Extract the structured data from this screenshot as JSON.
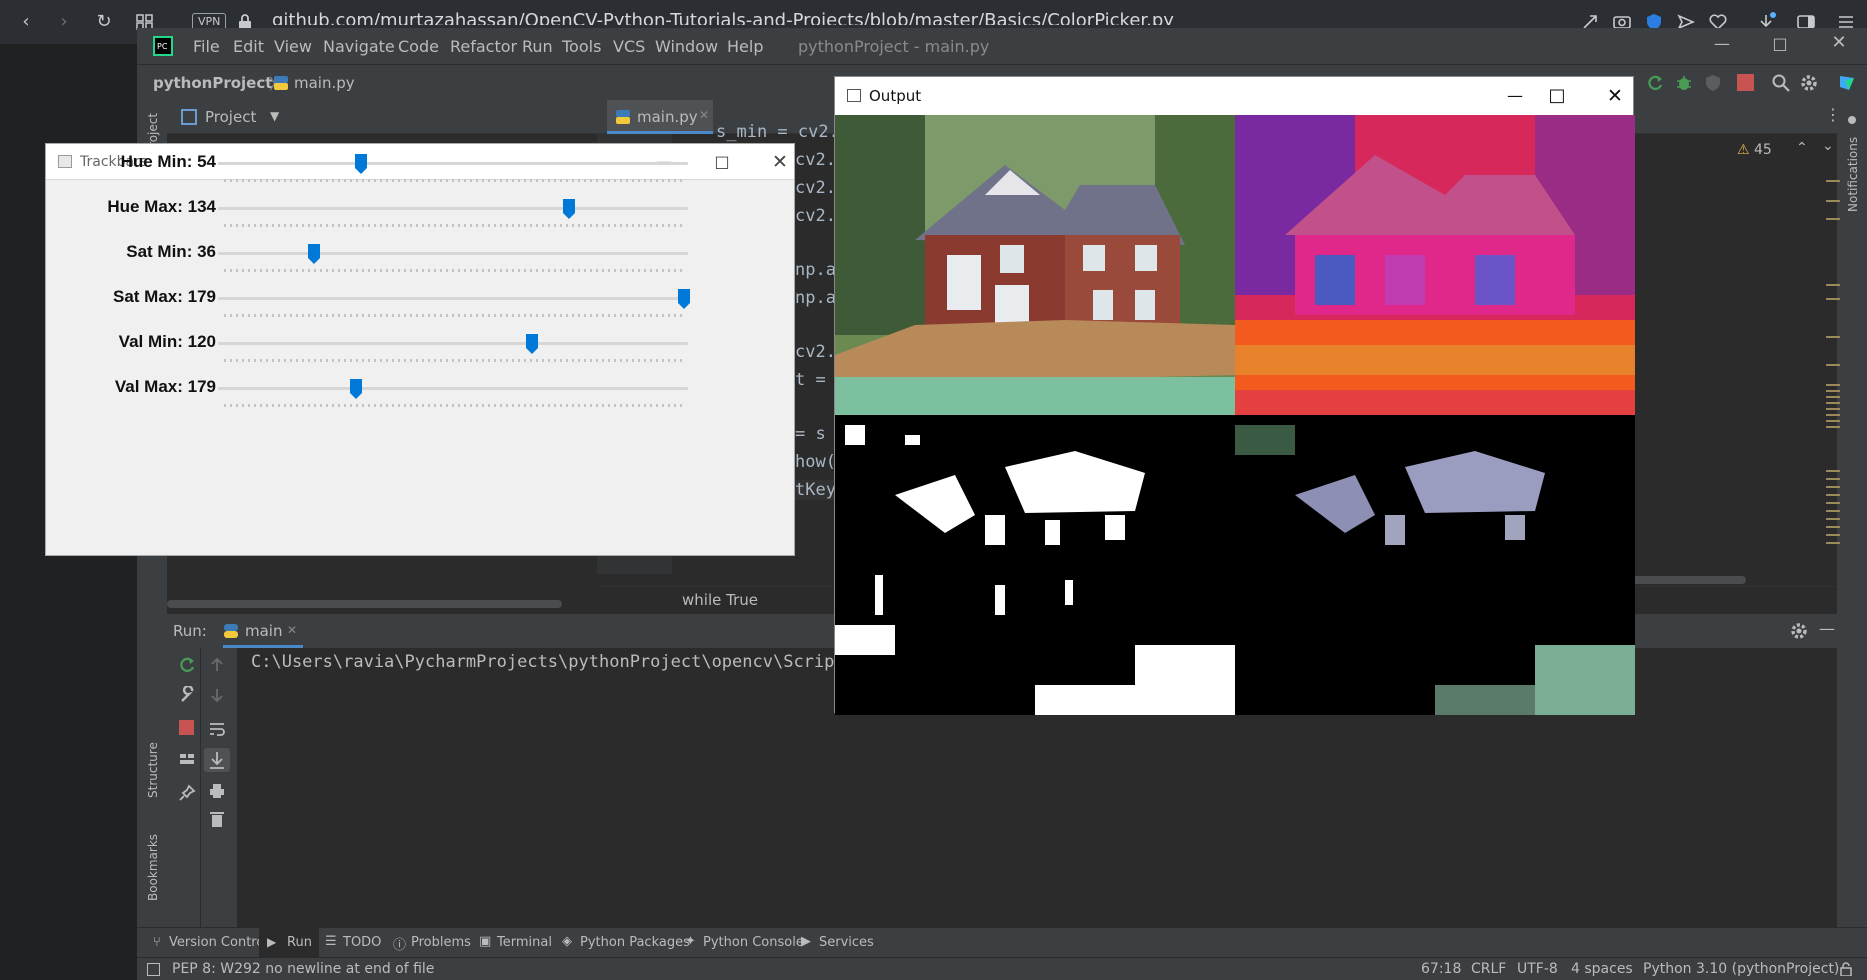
{
  "browser": {
    "url": "github.com/murtazahassan/OpenCV-Python-Tutorials-and-Projects/blob/master/Basics/ColorPicker.py",
    "vpn_label": "VPN"
  },
  "ide": {
    "menu": [
      "File",
      "Edit",
      "View",
      "Navigate",
      "Code",
      "Refactor",
      "Run",
      "Tools",
      "VCS",
      "Window",
      "Help"
    ],
    "window_title": "pythonProject - main.py",
    "breadcrumb_project": "pythonProject",
    "breadcrumb_file": "main.py",
    "project_panel_label": "Project",
    "editor_tab": "main.py",
    "warning_count": "45",
    "code_lines": [
      "s_min = cv2.",
      "cv2.",
      "cv2.",
      "cv2.",
      "np.a",
      "np.a",
      "cv2.i",
      "t =",
      "= s",
      "how(",
      "tKey("
    ],
    "context_breadcrumb": "while True",
    "left_tool_labels": [
      "Project",
      "Structure",
      "Bookmarks"
    ],
    "right_tool_label": "Notifications"
  },
  "run": {
    "label": "Run:",
    "tab": "main",
    "console_line": "C:\\Users\\ravia\\PycharmProjects\\pythonProject\\opencv\\Scripts"
  },
  "bottom_tools": [
    "Version Control",
    "Run",
    "TODO",
    "Problems",
    "Terminal",
    "Python Packages",
    "Python Console",
    "Services"
  ],
  "status": {
    "message": "PEP 8: W292 no newline at end of file",
    "position": "67:18",
    "line_sep": "CRLF",
    "encoding": "UTF-8",
    "indent": "4 spaces",
    "interpreter": "Python 3.10 (pythonProject)"
  },
  "trackbars_window": {
    "title": "Trackbars",
    "sliders": [
      {
        "label": "Hue Min: 54",
        "fraction": 0.3
      },
      {
        "label": "Hue Max: 134",
        "fraction": 0.75
      },
      {
        "label": "Sat Min: 36",
        "fraction": 0.2
      },
      {
        "label": "Sat Max: 179",
        "fraction": 1.0
      },
      {
        "label": "Val Min: 120",
        "fraction": 0.67
      },
      {
        "label": "Val Max: 179",
        "fraction": 0.29
      }
    ]
  },
  "output_window": {
    "title": "Output"
  },
  "colors": {
    "accent_blue": "#0078d7",
    "ide_bg": "#2b2b2b",
    "ide_panel": "#3c3f41",
    "run_green": "#499c54",
    "stop_red": "#c75450"
  }
}
